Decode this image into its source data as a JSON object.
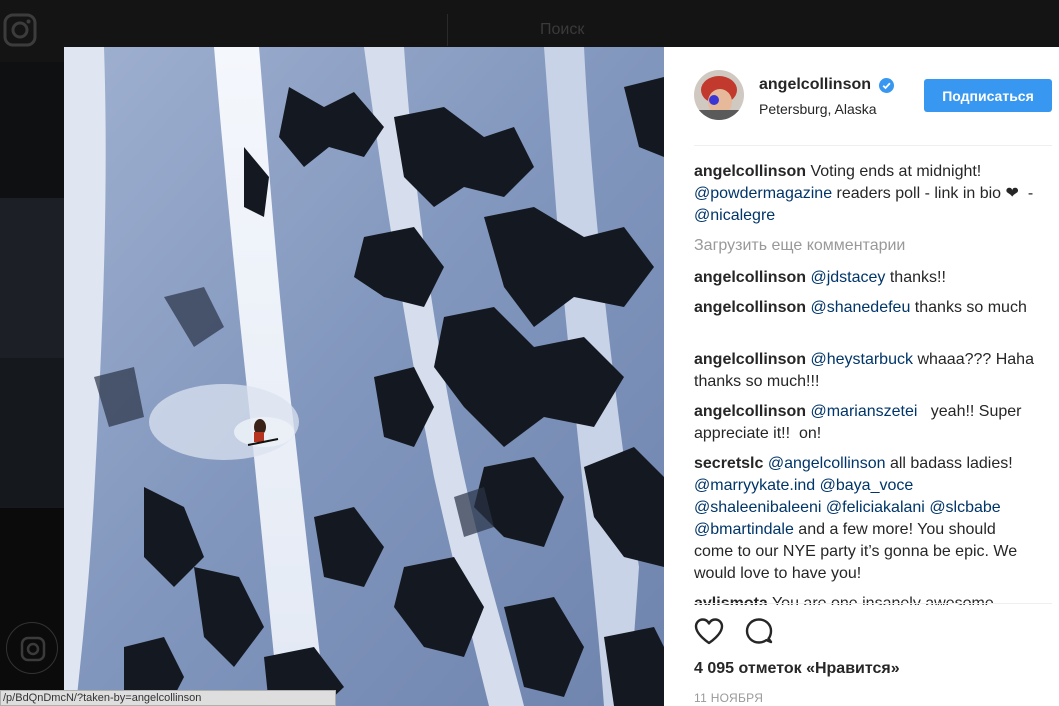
{
  "background": {
    "search_placeholder": "Поиск"
  },
  "post": {
    "author": {
      "username": "angelcollinson",
      "location": "Petersburg, Alaska",
      "verified": true
    },
    "follow_label": "Подписаться",
    "caption": {
      "user": "angelcollinson",
      "text_1": "Voting ends at midnight!",
      "mention_1": "@powdermagazine",
      "text_2": "readers poll - link in bio",
      "text_3": "❤︎ ‌ ‌-‌ ‌",
      "mention_2": "@nicalegre"
    },
    "load_more": "Загрузить еще комментарии",
    "comments": [
      {
        "user": "angelcollinson",
        "mention": "@jdstacey",
        "text": "thanks!! ‌ ‌"
      },
      {
        "user": "angelcollinson",
        "mention": "@shanedefeu",
        "text": "thanks so much ‌ ‌ ‌"
      },
      {
        "user": "angelcollinson",
        "mention": "@heystarbuck",
        "text": "whaaa??? Haha thanks so much!!!"
      },
      {
        "user": "angelcollinson",
        "mention": "@marianszetei",
        "text": "‌ ‌ yeah!! Super appreciate it!! ‌ ‌on!"
      },
      {
        "user": "secretslc",
        "mention": "@angelcollinson",
        "text": "all badass ladies!",
        "mentions_2": [
          "@marryykate.ind",
          "@baya_voce",
          "@shaleenibaleeni",
          "@feliciakalani",
          "@slcbabe",
          "@bmartindale"
        ],
        "text_2": "and a few more! You should come to our NYE party it’s gonna be epic. We would love to have you!"
      },
      {
        "user": "avlismota",
        "mention": "",
        "text": "You are one insanely awesome"
      }
    ],
    "likes": "4 095 отметок «Нравится»",
    "date": "11 НОЯБРЯ",
    "icons": {
      "like": "heart-icon",
      "comment": "comment-icon",
      "verified": "verified-badge-icon"
    }
  },
  "status_bar": {
    "url": "/p/BdQnDmcN/?taken-by=angelcollinson"
  }
}
